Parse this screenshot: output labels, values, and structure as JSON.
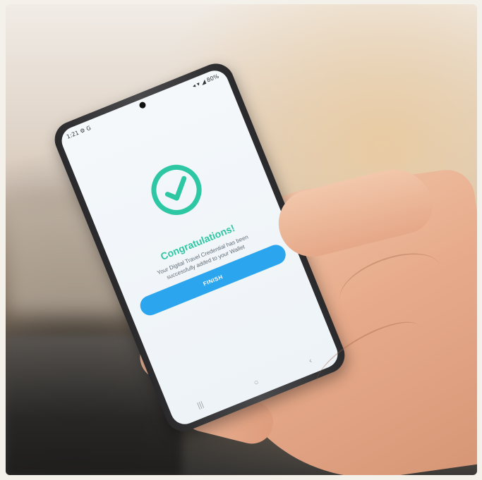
{
  "screen": {
    "status_time": "1:21",
    "status_icons_left": "⚙ G",
    "status_icons_right": "◂ ▾ ◢ 80%",
    "title": "Congratulations!",
    "message_line1": "Your Digital Travel Credential has been",
    "message_line2": "successfully added to your Wallet",
    "finish_label": "FINISH"
  },
  "colors": {
    "accent_green": "#2ec7a3",
    "button_blue": "#2aa5ee"
  },
  "icons": {
    "success": "check-circle-icon",
    "nav_recents": "recents-icon",
    "nav_home": "home-icon",
    "nav_back": "back-icon"
  }
}
